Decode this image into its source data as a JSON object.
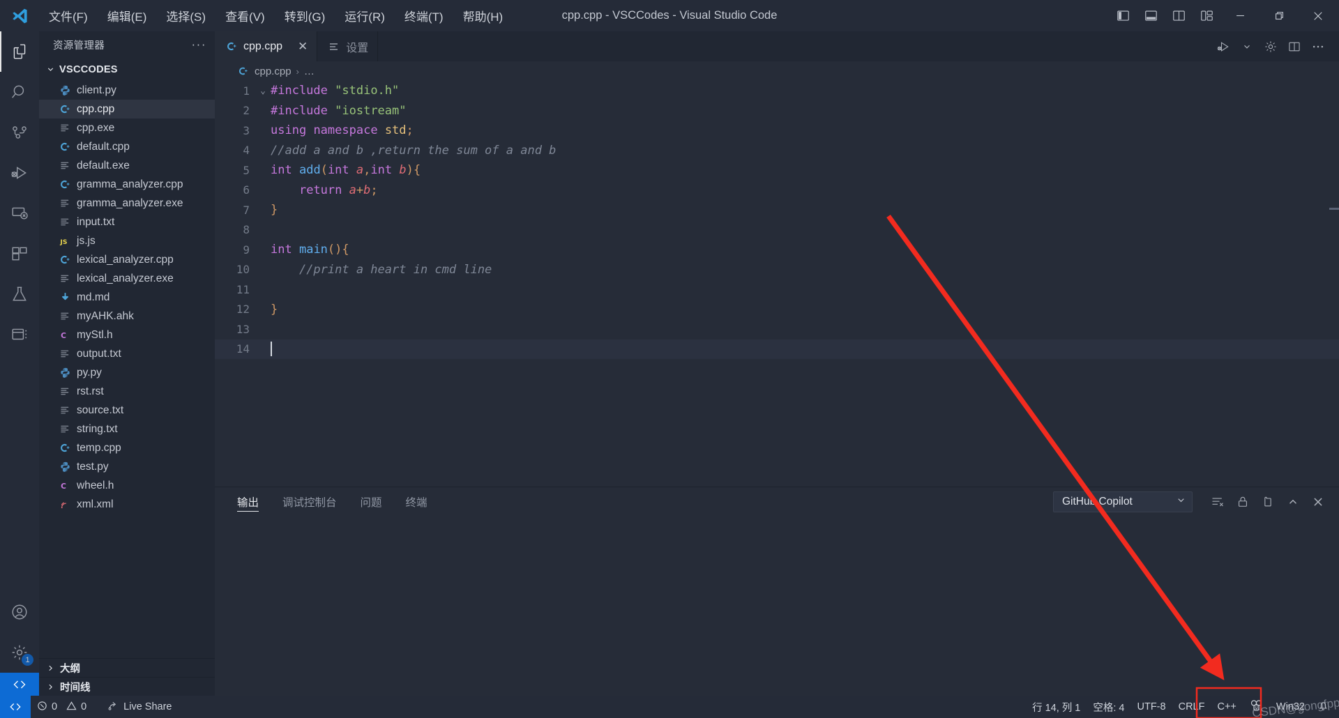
{
  "window": {
    "title": "cpp.cpp - VSCCodes - Visual Studio Code",
    "logo_icon": "vscode-logo-icon",
    "menu": [
      {
        "label": "文件(F)",
        "name": "menu-file"
      },
      {
        "label": "编辑(E)",
        "name": "menu-edit"
      },
      {
        "label": "选择(S)",
        "name": "menu-selection"
      },
      {
        "label": "查看(V)",
        "name": "menu-view"
      },
      {
        "label": "转到(G)",
        "name": "menu-go"
      },
      {
        "label": "运行(R)",
        "name": "menu-run"
      },
      {
        "label": "终端(T)",
        "name": "menu-terminal"
      },
      {
        "label": "帮助(H)",
        "name": "menu-help"
      }
    ],
    "layout_icons": [
      "toggle-primary-sidebar-icon",
      "toggle-panel-icon",
      "toggle-secondary-sidebar-icon",
      "customize-layout-icon"
    ],
    "controls": [
      "minimize-icon",
      "restore-icon",
      "close-icon"
    ]
  },
  "activitybar": {
    "items": [
      {
        "name": "activity-explorer",
        "icon": "files-icon",
        "active": true
      },
      {
        "name": "activity-search",
        "icon": "search-icon",
        "active": false
      },
      {
        "name": "activity-source-control",
        "icon": "source-control-icon",
        "active": false
      },
      {
        "name": "activity-run-debug",
        "icon": "run-and-debug-icon",
        "active": false
      },
      {
        "name": "activity-remote-explorer",
        "icon": "remote-explorer-icon",
        "active": false
      },
      {
        "name": "activity-extensions",
        "icon": "extensions-icon",
        "active": false
      },
      {
        "name": "activity-testing",
        "icon": "beaker-icon",
        "active": false
      },
      {
        "name": "activity-other",
        "icon": "panel-layout-icon",
        "active": false
      }
    ],
    "bottom": [
      {
        "name": "activity-accounts",
        "icon": "account-icon"
      },
      {
        "name": "activity-settings",
        "icon": "gear-icon",
        "badge": "1"
      }
    ],
    "remote_icon": "remote-window-icon"
  },
  "sidebar": {
    "title": "资源管理器",
    "more_actions": "···",
    "folder": {
      "label": "VSCCODES",
      "expanded": true
    },
    "files": [
      {
        "name": "client.py",
        "icon": "python-icon"
      },
      {
        "name": "cpp.cpp",
        "icon": "cpp-icon",
        "selected": true
      },
      {
        "name": "cpp.exe",
        "icon": "text-file-icon"
      },
      {
        "name": "default.cpp",
        "icon": "cpp-icon"
      },
      {
        "name": "default.exe",
        "icon": "text-file-icon"
      },
      {
        "name": "gramma_analyzer.cpp",
        "icon": "cpp-icon"
      },
      {
        "name": "gramma_analyzer.exe",
        "icon": "text-file-icon"
      },
      {
        "name": "input.txt",
        "icon": "text-file-icon"
      },
      {
        "name": "js.js",
        "icon": "js-icon"
      },
      {
        "name": "lexical_analyzer.cpp",
        "icon": "cpp-icon"
      },
      {
        "name": "lexical_analyzer.exe",
        "icon": "text-file-icon"
      },
      {
        "name": "md.md",
        "icon": "markdown-icon"
      },
      {
        "name": "myAHK.ahk",
        "icon": "text-file-icon"
      },
      {
        "name": "myStl.h",
        "icon": "c-header-icon"
      },
      {
        "name": "output.txt",
        "icon": "text-file-icon"
      },
      {
        "name": "py.py",
        "icon": "python-icon"
      },
      {
        "name": "rst.rst",
        "icon": "text-file-icon"
      },
      {
        "name": "source.txt",
        "icon": "text-file-icon"
      },
      {
        "name": "string.txt",
        "icon": "text-file-icon"
      },
      {
        "name": "temp.cpp",
        "icon": "cpp-icon"
      },
      {
        "name": "test.py",
        "icon": "python-icon"
      },
      {
        "name": "wheel.h",
        "icon": "c-header-icon"
      },
      {
        "name": "xml.xml",
        "icon": "xml-icon"
      }
    ],
    "collapsed_sections": [
      {
        "label": "大纲",
        "name": "sidebar-section-outline"
      },
      {
        "label": "时间线",
        "name": "sidebar-section-timeline"
      }
    ]
  },
  "editor": {
    "tabs": [
      {
        "label": "cpp.cpp",
        "icon": "cpp-icon",
        "active": true,
        "close": "✕"
      },
      {
        "label": "设置",
        "icon": "settings-file-icon",
        "active": false
      }
    ],
    "toolbar": [
      "run-and-debug-icon",
      "chevron-down-icon",
      "gear-icon",
      "split-editor-icon",
      "more-actions-icon"
    ],
    "breadcrumb": {
      "file": "cpp.cpp",
      "separator": "›",
      "rest": "…",
      "icon": "cpp-icon"
    },
    "lines": [
      {
        "n": "1",
        "fold": "⌄",
        "tokens": [
          {
            "t": "#include",
            "c": "k-pre"
          },
          {
            "t": " ",
            "c": ""
          },
          {
            "t": "\"stdio.h\"",
            "c": "k-str"
          }
        ]
      },
      {
        "n": "2",
        "fold": "",
        "tokens": [
          {
            "t": "#include",
            "c": "k-pre"
          },
          {
            "t": " ",
            "c": ""
          },
          {
            "t": "\"iostream\"",
            "c": "k-str"
          }
        ]
      },
      {
        "n": "3",
        "fold": "",
        "tokens": [
          {
            "t": "using",
            "c": "k-kw"
          },
          {
            "t": " ",
            "c": ""
          },
          {
            "t": "namespace",
            "c": "k-kw"
          },
          {
            "t": " ",
            "c": ""
          },
          {
            "t": "std",
            "c": "k-var"
          },
          {
            "t": ";",
            "c": "k-pun"
          }
        ]
      },
      {
        "n": "4",
        "fold": "",
        "tokens": [
          {
            "t": "//add a and b ,return the sum of a and b",
            "c": "k-cmt"
          }
        ]
      },
      {
        "n": "5",
        "fold": "",
        "tokens": [
          {
            "t": "int",
            "c": "k-kw"
          },
          {
            "t": " ",
            "c": ""
          },
          {
            "t": "add",
            "c": "k-fn"
          },
          {
            "t": "(",
            "c": "k-pun"
          },
          {
            "t": "int",
            "c": "k-kw"
          },
          {
            "t": " ",
            "c": ""
          },
          {
            "t": "a",
            "c": "k-par"
          },
          {
            "t": ",",
            "c": "k-pun"
          },
          {
            "t": "int",
            "c": "k-kw"
          },
          {
            "t": " ",
            "c": ""
          },
          {
            "t": "b",
            "c": "k-par"
          },
          {
            "t": ")",
            "c": "k-pun"
          },
          {
            "t": "{",
            "c": "k-pun"
          }
        ]
      },
      {
        "n": "6",
        "fold": "",
        "tokens": [
          {
            "t": "    ",
            "c": "indent-guide"
          },
          {
            "t": "return",
            "c": "k-ret"
          },
          {
            "t": " ",
            "c": ""
          },
          {
            "t": "a",
            "c": "k-par"
          },
          {
            "t": "+",
            "c": "k-pun"
          },
          {
            "t": "b",
            "c": "k-par"
          },
          {
            "t": ";",
            "c": "k-pun"
          }
        ]
      },
      {
        "n": "7",
        "fold": "",
        "tokens": [
          {
            "t": "}",
            "c": "k-pun"
          }
        ]
      },
      {
        "n": "8",
        "fold": "",
        "tokens": []
      },
      {
        "n": "9",
        "fold": "",
        "tokens": [
          {
            "t": "int",
            "c": "k-kw"
          },
          {
            "t": " ",
            "c": ""
          },
          {
            "t": "main",
            "c": "k-fn"
          },
          {
            "t": "(",
            "c": "k-pun"
          },
          {
            "t": ")",
            "c": "k-pun"
          },
          {
            "t": "{",
            "c": "k-pun"
          }
        ]
      },
      {
        "n": "10",
        "fold": "",
        "tokens": [
          {
            "t": "    ",
            "c": ""
          },
          {
            "t": "//print a heart in cmd line",
            "c": "k-cmt"
          }
        ]
      },
      {
        "n": "11",
        "fold": "",
        "tokens": []
      },
      {
        "n": "12",
        "fold": "",
        "tokens": [
          {
            "t": "}",
            "c": "k-pun"
          }
        ]
      },
      {
        "n": "13",
        "fold": "",
        "tokens": []
      },
      {
        "n": "14",
        "fold": "",
        "tokens": [],
        "current": true,
        "caret": true
      }
    ]
  },
  "panel": {
    "tabs": [
      {
        "label": "输出",
        "active": true,
        "name": "panel-tab-output"
      },
      {
        "label": "调试控制台",
        "active": false,
        "name": "panel-tab-debug-console"
      },
      {
        "label": "问题",
        "active": false,
        "name": "panel-tab-problems"
      },
      {
        "label": "终端",
        "active": false,
        "name": "panel-tab-terminal"
      }
    ],
    "channel_select": {
      "value": "GitHub Copilot",
      "chevron": "⌄"
    },
    "actions": [
      "clear-output-icon",
      "lock-icon",
      "open-in-editor-icon",
      "chevron-up-icon",
      "close-icon"
    ],
    "content": ""
  },
  "statusbar": {
    "remote_icon": "remote-window-icon",
    "left": [
      {
        "label": "0",
        "icon": "error-icon",
        "name": "status-errors"
      },
      {
        "label": "0",
        "icon": "warning-icon",
        "name": "status-warnings"
      },
      {
        "label": "Live Share",
        "icon": "live-share-icon",
        "name": "status-live-share"
      }
    ],
    "right": [
      {
        "label": "行 14, 列 1",
        "name": "status-cursor-position"
      },
      {
        "label": "空格: 4",
        "name": "status-indentation"
      },
      {
        "label": "UTF-8",
        "name": "status-encoding"
      },
      {
        "label": "CRLF",
        "name": "status-eol"
      },
      {
        "label": "C++",
        "name": "status-language-mode"
      },
      {
        "label": "",
        "icon": "smiley-feedback-icon",
        "name": "status-feedback"
      },
      {
        "label": "Win32",
        "name": "status-platform"
      },
      {
        "label": "",
        "icon": "bell-icon",
        "name": "status-notifications"
      }
    ]
  },
  "annotations": {
    "arrow_color": "#f22b1f",
    "highlight_box_color": "#f22b1f",
    "watermark_text": "CSDN@gongfpp"
  }
}
